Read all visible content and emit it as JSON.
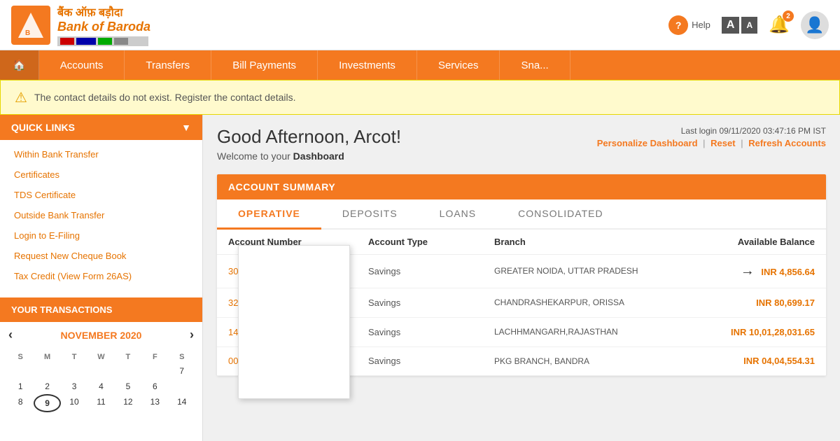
{
  "header": {
    "bank_name_hindi": "बैंक ऑफ़ बड़ौदा",
    "bank_name_eng": "Bank of Baroda",
    "help_label": "Help",
    "font_large": "A",
    "font_small": "A",
    "bell_badge": "2"
  },
  "nav": {
    "home_icon": "🏠",
    "items": [
      {
        "label": "Accounts"
      },
      {
        "label": "Transfers"
      },
      {
        "label": "Bill Payments"
      },
      {
        "label": "Investments"
      },
      {
        "label": "Services"
      },
      {
        "label": "Sna..."
      }
    ]
  },
  "alert": {
    "text": "The contact details do not exist. Register the contact details."
  },
  "sidebar": {
    "quick_links_title": "QUICK LINKS",
    "links": [
      "Within Bank Transfer",
      "Certificates",
      "TDS Certificate",
      "Outside Bank Transfer",
      "Login to E-Filing",
      "Request New Cheque Book",
      "Tax Credit (View Form 26AS)"
    ],
    "transactions_title": "YOUR TRANSACTIONS",
    "calendar": {
      "month": "NOVEMBER 2020",
      "days_header": [
        "S",
        "M",
        "T",
        "W",
        "T",
        "F",
        "S"
      ],
      "weeks": [
        [
          "",
          "2",
          "3",
          "4",
          "5",
          "6",
          "7"
        ],
        [
          "8",
          "9",
          "10",
          "11",
          "12",
          "13",
          "14"
        ],
        [
          "1",
          "",
          "",
          "",
          "",
          "",
          ""
        ]
      ],
      "today": "9",
      "first_row": [
        "1",
        "2",
        "3",
        "4",
        "5",
        "6",
        "7"
      ]
    }
  },
  "content": {
    "greeting": "Good Afternoon, Arcot!",
    "welcome": "Welcome to your",
    "dashboard_bold": "Dashboard",
    "last_login_label": "Last login 09/11/2020 03:47:16 PM IST",
    "personalize_label": "Personalize Dashboard",
    "reset_label": "Reset",
    "refresh_label": "Refresh Accounts",
    "account_summary_title": "ACCOUNT SUMMARY",
    "tabs": [
      "OPERATIVE",
      "DEPOSITS",
      "LOANS",
      "CONSOLIDATED"
    ],
    "active_tab": "OPERATIVE",
    "table_headers": {
      "account_number": "Account Number",
      "account_type": "Account Type",
      "branch": "Branch",
      "available_balance": "Available Balance"
    },
    "rows": [
      {
        "account_number": "30...",
        "account_type": "Savings",
        "branch": "GREATER NOIDA, UTTAR PRADESH",
        "balance": "INR  4,856.64",
        "highlight_arrow": true
      },
      {
        "account_number": "32...",
        "account_type": "Savings",
        "branch": "CHANDRASHEKARPUR, ORISSA",
        "balance": "INR  80,699.17",
        "highlight_arrow": false
      },
      {
        "account_number": "14...",
        "account_type": "Savings",
        "branch": "LACHHMANGARH,RAJASTHAN",
        "balance": "INR  10,01,28,031.65",
        "highlight_arrow": false
      },
      {
        "account_number": "000...",
        "account_type": "Savings",
        "branch": "PKG BRANCH, BANDRA",
        "balance": "INR  04,04,554.31",
        "highlight_arrow": false
      }
    ]
  }
}
